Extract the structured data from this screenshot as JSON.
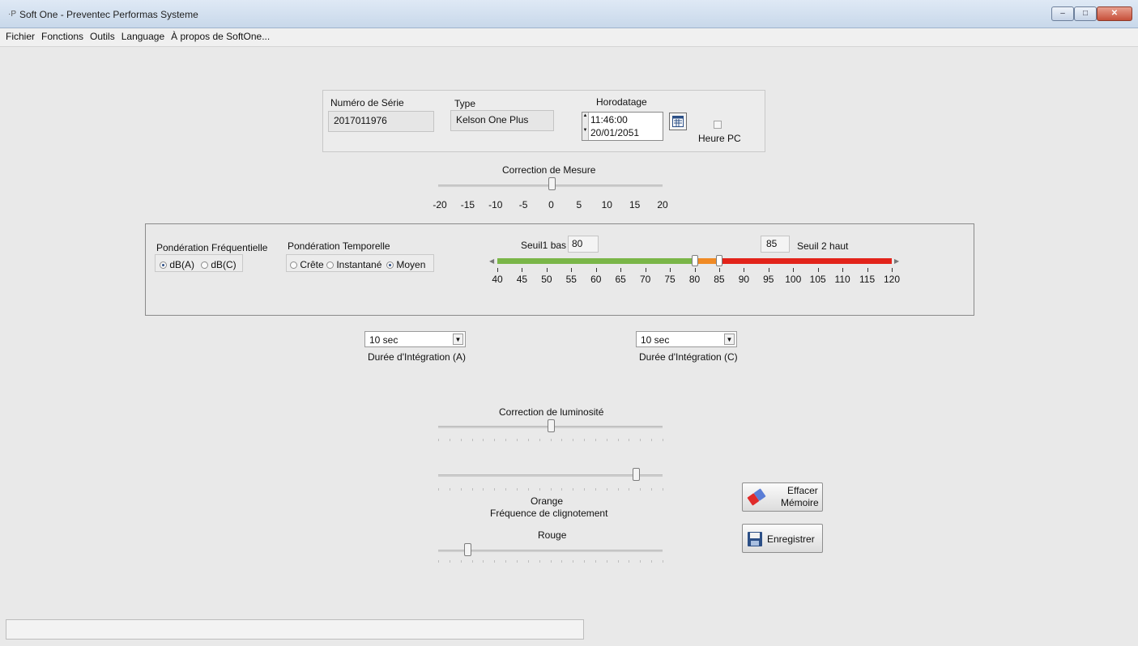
{
  "window": {
    "title": "Soft One - Preventec Performas Systeme",
    "app_icon": "·P",
    "controls": {
      "minimize": "–",
      "maximize": "□",
      "close": "✕"
    }
  },
  "menu": [
    "Fichier",
    "Fonctions",
    "Outils",
    "Language",
    "À propos de SoftOne..."
  ],
  "device": {
    "serial_label": "Numéro de Série",
    "serial_value": "2017011976",
    "type_label": "Type",
    "type_value": "Kelson One Plus",
    "timestamp_label": "Horodatage",
    "time_value": "11:46:00",
    "date_value": "20/01/2051",
    "pc_time_label": "Heure PC",
    "pc_time_checked": false
  },
  "correction_mesure": {
    "label": "Correction de Mesure",
    "ticks": [
      "-20",
      "-15",
      "-10",
      "-5",
      "0",
      "5",
      "10",
      "15",
      "20"
    ],
    "value": 0,
    "min": -20,
    "max": 20
  },
  "ponderation_frequentielle": {
    "label": "Pondération Fréquentielle",
    "options": [
      "dB(A)",
      "dB(C)"
    ],
    "selected": "dB(A)"
  },
  "ponderation_temporelle": {
    "label": "Pondération Temporelle",
    "options": [
      "Crête",
      "Instantané",
      "Moyen"
    ],
    "selected": "Moyen"
  },
  "seuils": {
    "seuil1_label": "Seuil1 bas",
    "seuil1_value": "80",
    "seuil2_label": "Seuil 2 haut",
    "seuil2_value": "85",
    "ticks": [
      "40",
      "45",
      "50",
      "55",
      "60",
      "65",
      "70",
      "75",
      "80",
      "85",
      "90",
      "95",
      "100",
      "105",
      "110",
      "115",
      "120"
    ],
    "min": 40,
    "max": 120,
    "colors": {
      "green": "#7ab648",
      "orange": "#f08a24",
      "red": "#e2231a"
    }
  },
  "integration": {
    "a_value": "10 sec",
    "a_label": "Durée d'Intégration (A)",
    "c_value": "10 sec",
    "c_label": "Durée d'Intégration (C)"
  },
  "luminosite": {
    "label": "Correction de luminosité",
    "level": 0.5
  },
  "clignotement": {
    "orange_label": "Orange",
    "frequence_label": "Fréquence de clignotement",
    "orange_level": 0.88,
    "rouge_label": "Rouge",
    "rouge_level": 0.13
  },
  "buttons": {
    "effacer_line1": "Effacer",
    "effacer_line2": "Mémoire",
    "enregistrer": "Enregistrer"
  },
  "status": ""
}
